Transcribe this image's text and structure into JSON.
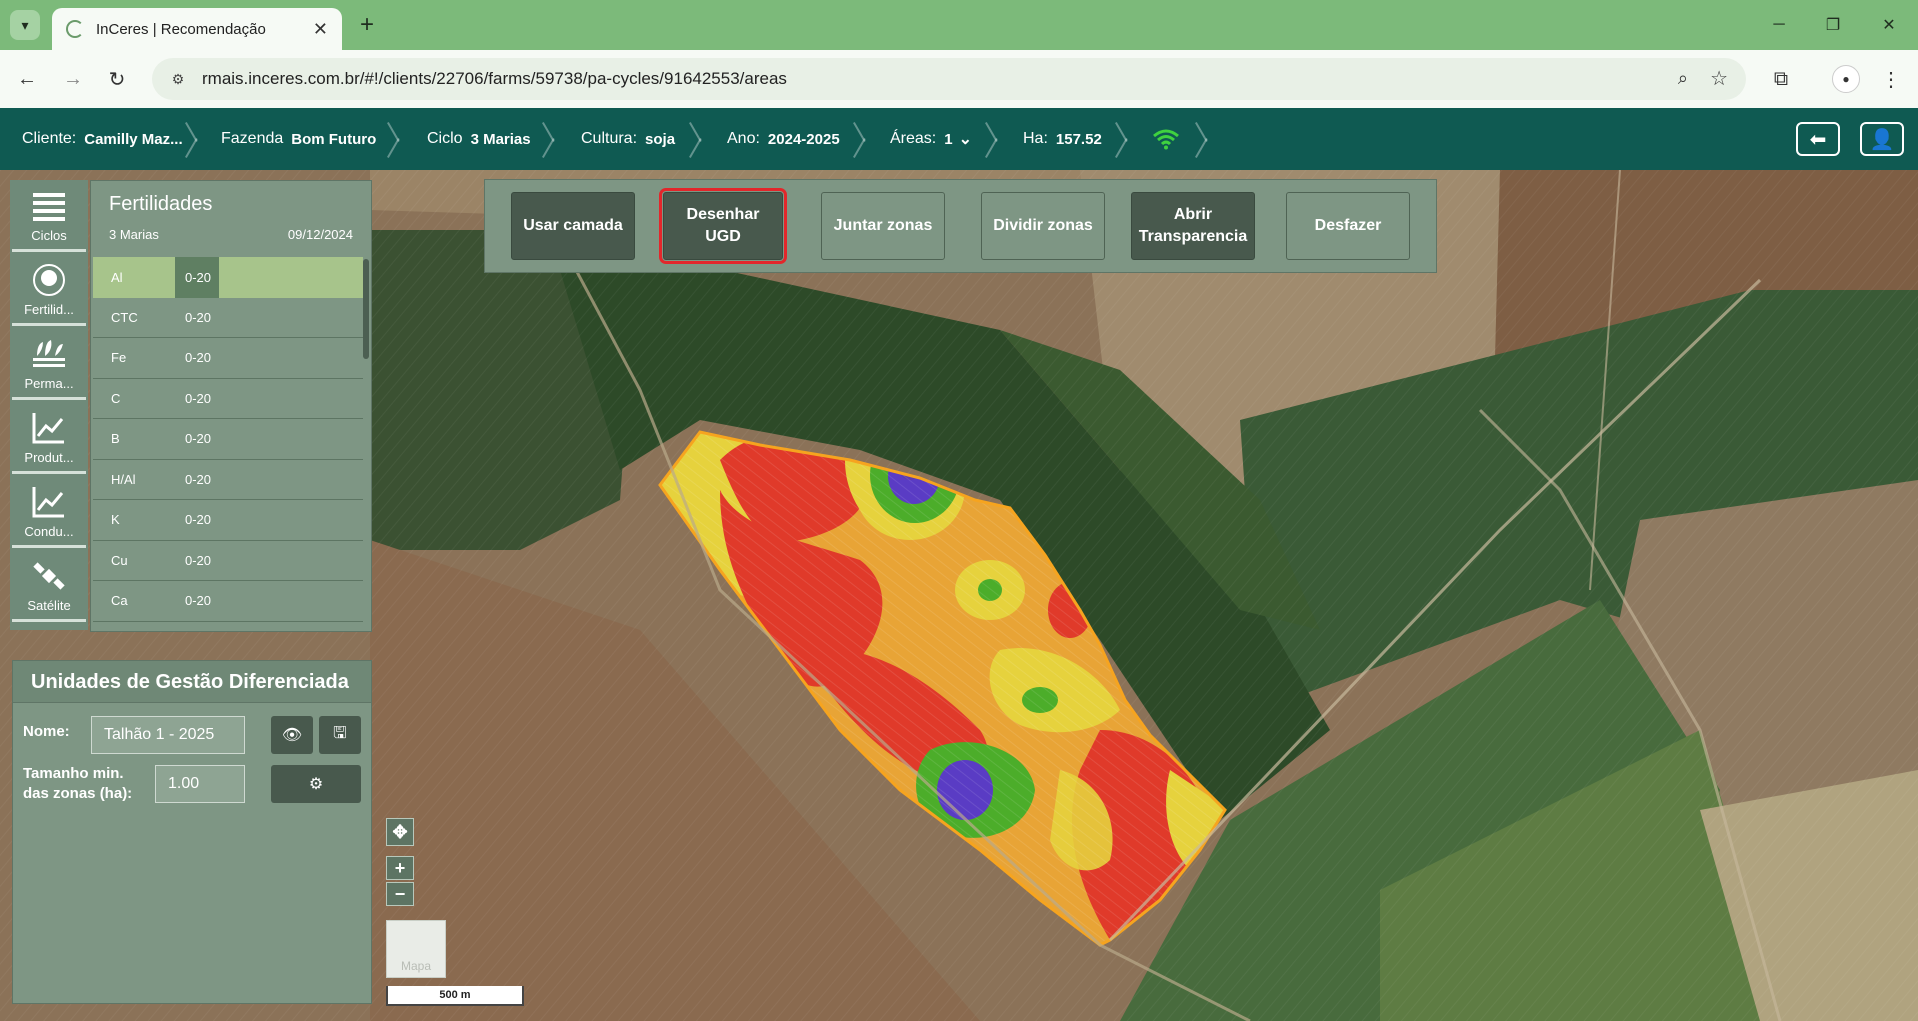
{
  "browser": {
    "tab_title": "InCeres | Recomendação",
    "url": "rmais.inceres.com.br/#!/clients/22706/farms/59738/pa-cycles/91642553/areas"
  },
  "header": {
    "cliente_label": "Cliente:",
    "cliente_value": "Camilly Maz...",
    "fazenda_label": "Fazenda",
    "fazenda_value": "Bom Futuro",
    "ciclo_label": "Ciclo",
    "ciclo_value": "3 Marias",
    "cultura_label": "Cultura:",
    "cultura_value": "soja",
    "ano_label": "Ano:",
    "ano_value": "2024-2025",
    "areas_label": "Áreas:",
    "areas_value": "1",
    "ha_label": "Ha:",
    "ha_value": "157.52"
  },
  "sidebar": {
    "items": [
      {
        "label": "Ciclos",
        "icon": "list-icon"
      },
      {
        "label": "Fertilid...",
        "icon": "fertility-icon"
      },
      {
        "label": "Perma...",
        "icon": "plants-icon"
      },
      {
        "label": "Produt...",
        "icon": "chart-line-icon"
      },
      {
        "label": "Condu...",
        "icon": "chart-line-icon"
      },
      {
        "label": "Satélite",
        "icon": "satellite-icon"
      }
    ]
  },
  "fertility": {
    "title": "Fertilidades",
    "subtitle": "3 Marias",
    "date": "09/12/2024",
    "rows": [
      {
        "name": "Al",
        "depth": "0-20"
      },
      {
        "name": "CTC",
        "depth": "0-20"
      },
      {
        "name": "Fe",
        "depth": "0-20"
      },
      {
        "name": "C",
        "depth": "0-20"
      },
      {
        "name": "B",
        "depth": "0-20"
      },
      {
        "name": "H/Al",
        "depth": "0-20"
      },
      {
        "name": "K",
        "depth": "0-20"
      },
      {
        "name": "Cu",
        "depth": "0-20"
      },
      {
        "name": "Ca",
        "depth": "0-20"
      }
    ],
    "selected_index": 0
  },
  "ugd": {
    "title": "Unidades de Gestão Diferenciada",
    "nome_label": "Nome:",
    "nome_value": "Talhão 1 - 2025",
    "tamanho_label_1": "Tamanho min.",
    "tamanho_label_2": "das zonas (ha):",
    "tamanho_value": "1.00"
  },
  "actions": {
    "usar_camada": "Usar camada",
    "desenhar_1": "Desenhar",
    "desenhar_2": "UGD",
    "juntar": "Juntar zonas",
    "dividir": "Dividir zonas",
    "abrir_1": "Abrir",
    "abrir_2": "Transparencia",
    "desfazer": "Desfazer"
  },
  "map": {
    "layer_button": "Mapa",
    "scale": "500 m",
    "zone_colors": [
      "#e03a2a",
      "#e8a033",
      "#e6d23d",
      "#4cad2a",
      "#5a3cc4"
    ]
  }
}
